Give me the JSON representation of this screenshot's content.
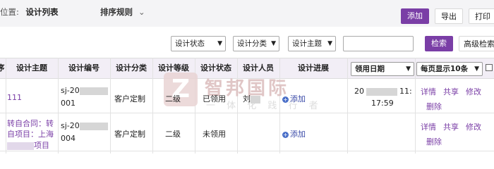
{
  "header": {
    "breadcrumb_prefix": "位置:",
    "breadcrumb_current": "设计列表",
    "sort_label": "排序规则",
    "add_label": "添加",
    "export_label": "导出",
    "print_label": "打印"
  },
  "filters": {
    "status": "设计状态",
    "category": "设计分类",
    "topic": "设计主题",
    "search_label": "检索",
    "advanced_label": "高级检索"
  },
  "table": {
    "columns": {
      "topic": "设计主题",
      "code": "设计编号",
      "category": "设计分类",
      "level": "设计等级",
      "status": "设计状态",
      "person": "设计人员",
      "progress": "设计进展",
      "date_select": "领用日期",
      "page_size_select": "每页显示10条",
      "left_partial": "序"
    },
    "rows": [
      {
        "topic": "111",
        "code_line1": "sj-20",
        "code_line2": "001",
        "category": "客户定制",
        "level": "二级",
        "status": "已领用",
        "person": "刘",
        "progress": "添加",
        "date_line1_start": "20",
        "date_line1_end": "11:",
        "date_line2": "17:59",
        "ops": [
          "详情",
          "共享",
          "修改",
          "删除"
        ]
      },
      {
        "topic_line1": "转自合同：转",
        "topic_line2": "自项目：上海",
        "topic_line3": "项目",
        "code_line1": "sj-20",
        "code_line2": "004",
        "category": "客户定制",
        "level": "二级",
        "status": "未领用",
        "progress": "添加",
        "ops": [
          "详情",
          "共享",
          "修改",
          "删除"
        ]
      }
    ]
  },
  "watermark": {
    "brand": "智邦国际",
    "slogan": "一 体 化 践 行 者",
    "logo_letter": "Z"
  }
}
